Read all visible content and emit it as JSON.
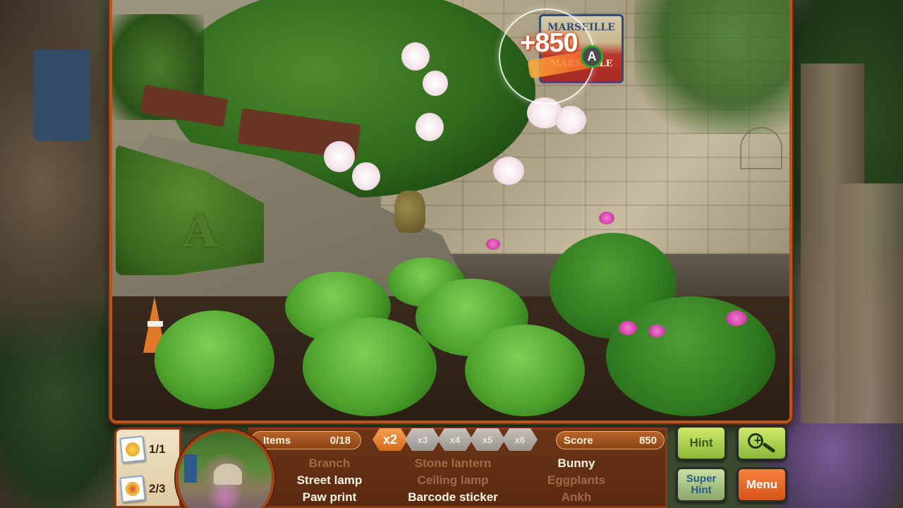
{
  "scene": {
    "sign_top_text": "MARSEILLE",
    "sign_bottom_text": "MARSEILLE",
    "hedge_letter": "A",
    "popup_score": "+850",
    "popup_badge": "A"
  },
  "counters": [
    {
      "icon": "star-photo-icon",
      "value": "1/1"
    },
    {
      "icon": "compass-photo-icon",
      "value": "2/3"
    }
  ],
  "hud": {
    "items_label": "Items",
    "items_value": "0/18",
    "score_label": "Score",
    "score_value": "850",
    "multipliers": [
      {
        "label": "x2",
        "active": true
      },
      {
        "label": "x3",
        "active": false
      },
      {
        "label": "x4",
        "active": false
      },
      {
        "label": "x5",
        "active": false
      },
      {
        "label": "x6",
        "active": false
      }
    ],
    "words": [
      {
        "text": "Branch",
        "found": true
      },
      {
        "text": "Stone lantern",
        "found": true
      },
      {
        "text": "Bunny",
        "found": false
      },
      {
        "text": "Street lamp",
        "found": false
      },
      {
        "text": "Ceiling lamp",
        "found": true
      },
      {
        "text": "Eggplants",
        "found": true
      },
      {
        "text": "Paw print",
        "found": false
      },
      {
        "text": "Barcode sticker",
        "found": false
      },
      {
        "text": "Ankh",
        "found": true
      }
    ]
  },
  "buttons": {
    "hint": "Hint",
    "super_hint": "Super Hint",
    "menu": "Menu",
    "zoom_icon": "zoom-in-icon"
  },
  "colors": {
    "frame": "#b8551e",
    "hud_bg": "#5a2a10",
    "word_active": "#fdf6e8",
    "word_found": "#a06a48",
    "hint_green": "#8ab83a",
    "menu_orange": "#d65418"
  }
}
